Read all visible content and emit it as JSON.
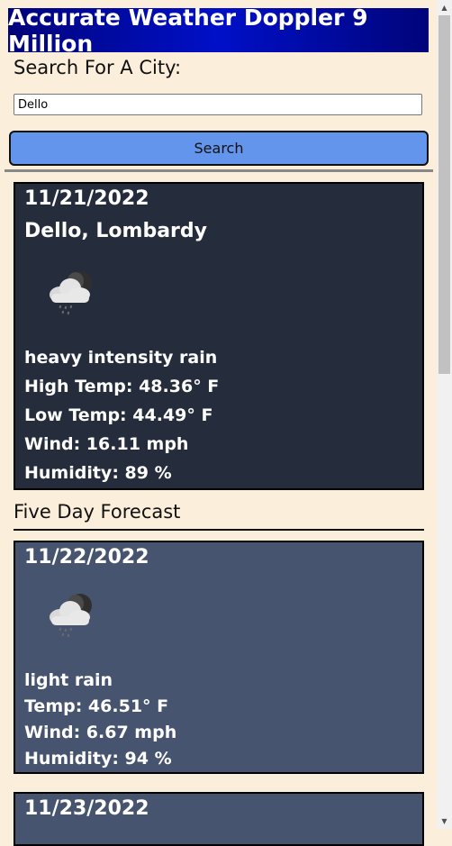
{
  "header": {
    "title": "Accurate Weather Doppler 9 Million"
  },
  "search": {
    "label": "Search For A City:",
    "value": "Dello",
    "button_label": "Search"
  },
  "current": {
    "date": "11/21/2022",
    "city": "Dello, Lombardy",
    "icon": "rain-cloud-moon-icon",
    "description": "heavy intensity rain",
    "high": "High Temp: 48.36° F",
    "low": "Low Temp: 44.49° F",
    "wind": "Wind: 16.11 mph",
    "humidity": "Humidity: 89 %"
  },
  "forecast": {
    "title": "Five Day Forecast",
    "days": [
      {
        "date": "11/22/2022",
        "icon": "rain-cloud-moon-icon",
        "description": "light rain",
        "temp": "Temp: 46.51° F",
        "wind": "Wind: 6.67 mph",
        "humidity": "Humidity: 94 %"
      },
      {
        "date": "11/23/2022"
      }
    ]
  },
  "colors": {
    "page_bg": "#fbeedb",
    "header_bg": "#0010c8",
    "button_bg": "#6495ed",
    "current_card_bg": "#252d3d",
    "forecast_card_bg": "#475470"
  }
}
